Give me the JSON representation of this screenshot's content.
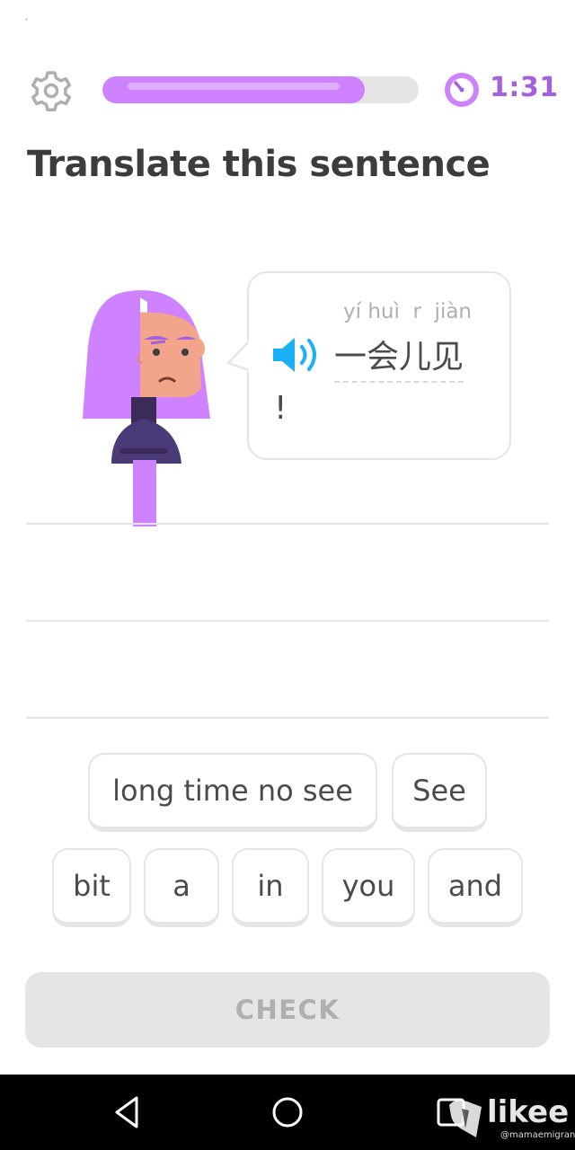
{
  "header": {
    "progress_fraction": 0.83,
    "timer": "1:31"
  },
  "title": "Translate this sentence",
  "prompt": {
    "pinyin": "yí huì  r  jiàn",
    "hanzi": "一会儿见",
    "punctuation": "!"
  },
  "word_bank": {
    "row1": [
      "long time no see",
      "See"
    ],
    "row2": [
      "bit",
      "a",
      "in",
      "you",
      "and"
    ]
  },
  "check_label": "CHECK",
  "watermark": {
    "brand": "likee",
    "handle": "@mamaemigrante"
  },
  "colors": {
    "accent": "#ce82ff",
    "timer": "#a560e0",
    "speaker": "#1cb0f6",
    "disabled": "#e5e5e5"
  },
  "icons": [
    "gear-icon",
    "timer-icon",
    "speaker-icon",
    "back-nav-icon",
    "home-nav-icon",
    "recents-nav-icon"
  ]
}
